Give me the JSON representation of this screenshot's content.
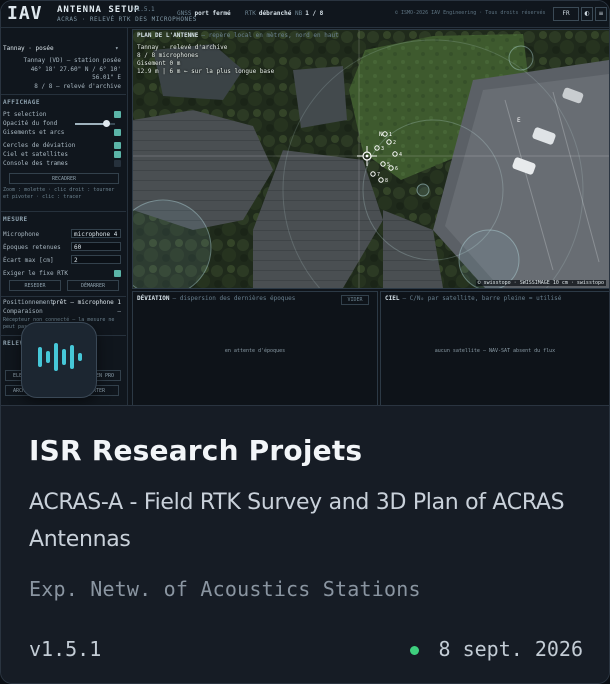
{
  "screenshot": {
    "logo": "IAV",
    "app_title": "ANTENNA SETUP",
    "app_version": "v1.5.1",
    "app_subtitle": "ACRAS · RELEVÉ RTK DES MICROPHONES",
    "stats": [
      {
        "key": "GNSS",
        "value": "port fermé"
      },
      {
        "key": "RTK",
        "value": "débranché"
      },
      {
        "key": "NB",
        "value": "1 / 8"
      }
    ],
    "copyright": "© ISMO-2026 IAV Engineering · Tous droits réservés",
    "language": "FR",
    "sidebar": {
      "station_select": "Tannay · posée",
      "station_name": "Tannay (VD) — station posée",
      "coords_lat": "46° 18' 27.60\" N / 6° 10'",
      "coords_lon": "56.01\" E",
      "survey": "8 / 8 — relevé d'archive",
      "section_display": "AFFICHAGE",
      "layers": [
        {
          "label": "Pt selection",
          "checked": true
        },
        {
          "label": "Opacité du fond",
          "checked": false
        },
        {
          "label": "Gisements et arcs",
          "checked": true
        },
        {
          "label": "Cercles de déviation",
          "checked": true
        },
        {
          "label": "Ciel et satellites",
          "checked": true
        },
        {
          "label": "Console des trames",
          "checked": false
        }
      ],
      "opacity_level": 0.78,
      "recenter_button": "RECADRER",
      "hint": "Zoom : molette · clic droit : tourner et pivoter · clic : tracer",
      "section_measure": "MESURE",
      "mic_label": "Microphone",
      "mic_value": "microphone 4",
      "epochs_label": "Époques retenues",
      "epochs_value": "60",
      "hdop_label": "Écart max [cm]",
      "hdop_value": "2",
      "fix_label": "Exiger le fixe RTK",
      "fix_checked": true,
      "btn_reset": "RESEDER",
      "btn_start": "DÉMARRER",
      "positioning_label": "Positionnement",
      "positioning_value": "prêt — microphone 1",
      "comparison_label": "Comparaison",
      "comparison_value": "—",
      "status_msg": "Récepteur non connecté — la mesure ne peut pas commencer",
      "section_relevé": "RELEVÉ",
      "btn_left": "ELEK",
      "btn_right": "EN PRO",
      "btn_export": "EXPORTER",
      "btn_archive": "ARCHIVE JSON"
    },
    "map": {
      "title": "PLAN DE L'ANTENNE",
      "subtitle": "— repère local en mètres, nord en haut",
      "overlay_lines": [
        "Tannay · relevé d'archive",
        "8 / 8 microphones",
        "Gisement 0 m",
        "12.9 m | 6 m ← sur la plus longue base"
      ],
      "attribution": "© swisstopo · SWISSIMAGE 10 cm · swisstopo",
      "mic_labels": [
        "1",
        "2",
        "3",
        "4",
        "5",
        "6",
        "7",
        "8"
      ]
    },
    "deviation_panel": {
      "title": "DÉVIATION",
      "subtitle": "— dispersion des dernières époques",
      "button": "VIDER",
      "empty": "en attente d'époques"
    },
    "sky_panel": {
      "title": "CIEL",
      "subtitle": "— C/N₀ par satellite, barre pleine = utilisé",
      "empty": "aucun satellite — NAV-SAT absent du flux"
    }
  },
  "card": {
    "title": "ISR Research Projets",
    "description": "ACRAS-A - Field RTK Survey and 3D Plan of ACRAS Antennas",
    "tagline": "Exp. Netw. of Acoustics Stations",
    "version": "v1.5.1",
    "date": "8 sept. 2026",
    "status_color": "#3ecf7e",
    "icon": "waveform-icon"
  }
}
